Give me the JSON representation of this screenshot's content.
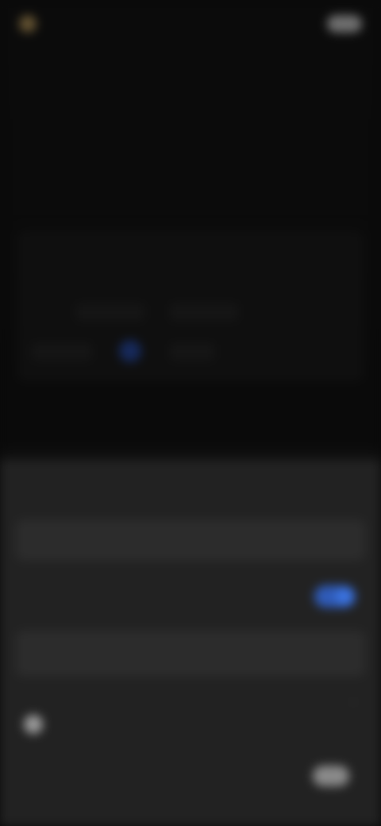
{
  "top_bar": {
    "brand_text": "",
    "action_text": ""
  },
  "upper": {
    "section_label": "",
    "header_text": "",
    "card_rows": [
      "",
      "",
      ""
    ],
    "chips": [
      "",
      "",
      "",
      ""
    ]
  },
  "sheet": {
    "title": "",
    "rows": [
      {
        "label": ""
      },
      {
        "label": ""
      },
      {
        "label": ""
      },
      {
        "label": ""
      }
    ],
    "bottom_label": "",
    "bottom_sub": ""
  },
  "colors": {
    "accent": "#3b73e0",
    "background": "#0a0a0a",
    "sheet": "#222222"
  }
}
